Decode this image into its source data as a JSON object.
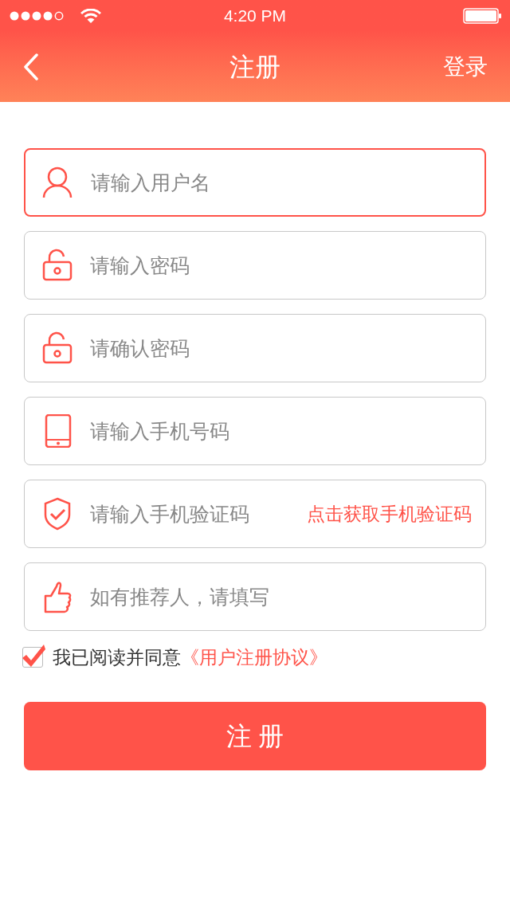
{
  "status_bar": {
    "time": "4:20 PM"
  },
  "nav": {
    "title": "注册",
    "action": "登录"
  },
  "fields": [
    {
      "kind": "user",
      "placeholder": "请输入用户名",
      "focused": true
    },
    {
      "kind": "lock",
      "placeholder": "请输入密码",
      "focused": false
    },
    {
      "kind": "lock",
      "placeholder": "请确认密码",
      "focused": false
    },
    {
      "kind": "phone",
      "placeholder": "请输入手机号码",
      "focused": false
    },
    {
      "kind": "shield",
      "placeholder": "请输入手机验证码",
      "focused": false,
      "action": "点击获取手机验证码"
    },
    {
      "kind": "thumb",
      "placeholder": "如有推荐人，请填写",
      "focused": false
    }
  ],
  "agreement": {
    "checked": true,
    "text": "我已阅读并同意",
    "link": "《用户注册协议》"
  },
  "submit": "注 册"
}
